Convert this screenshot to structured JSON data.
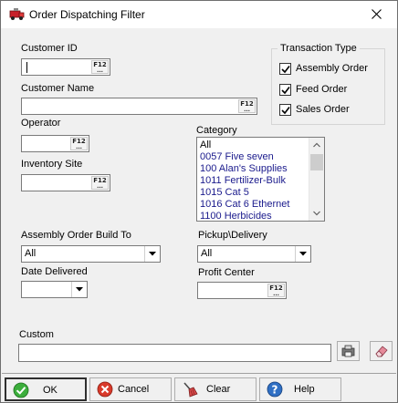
{
  "window": {
    "title": "Order Dispatching Filter"
  },
  "fields": {
    "customer_id": {
      "label": "Customer ID",
      "value": "",
      "lookup_key": "F12"
    },
    "customer_name": {
      "label": "Customer Name",
      "value": "",
      "lookup_key": "F12"
    },
    "operator": {
      "label": "Operator",
      "value": "",
      "lookup_key": "F12"
    },
    "inventory_site": {
      "label": "Inventory Site",
      "value": "",
      "lookup_key": "F12"
    },
    "assembly_order_build_to": {
      "label": "Assembly Order Build To",
      "selected": "All"
    },
    "date_delivered": {
      "label": "Date Delivered",
      "selected": ""
    },
    "pickup_delivery": {
      "label": "Pickup\\Delivery",
      "selected": "All"
    },
    "profit_center": {
      "label": "Profit Center",
      "value": "",
      "lookup_key": "F12"
    },
    "custom": {
      "label": "Custom",
      "value": ""
    }
  },
  "transaction_type": {
    "legend": "Transaction Type",
    "options": [
      {
        "label": "Assembly Order",
        "checked": true
      },
      {
        "label": "Feed Order",
        "checked": true
      },
      {
        "label": "Sales Order",
        "checked": true
      }
    ]
  },
  "category": {
    "label": "Category",
    "items": [
      "All",
      "0057 Five seven",
      "100 Alan's Supplies",
      "1011 Fertilizer-Bulk",
      "1015 Cat 5",
      "1016 Cat 6 Ethernet",
      "1100 Herbicides"
    ]
  },
  "buttons": {
    "ok": "OK",
    "cancel": "Cancel",
    "clear": "Clear",
    "help": "Help"
  },
  "colors": {
    "window_bg": "#f0f0f0",
    "list_text": "#1a1a8c",
    "ok_green": "#3cae3c",
    "cancel_red": "#d93a2b",
    "help_blue": "#2f6fc4"
  }
}
